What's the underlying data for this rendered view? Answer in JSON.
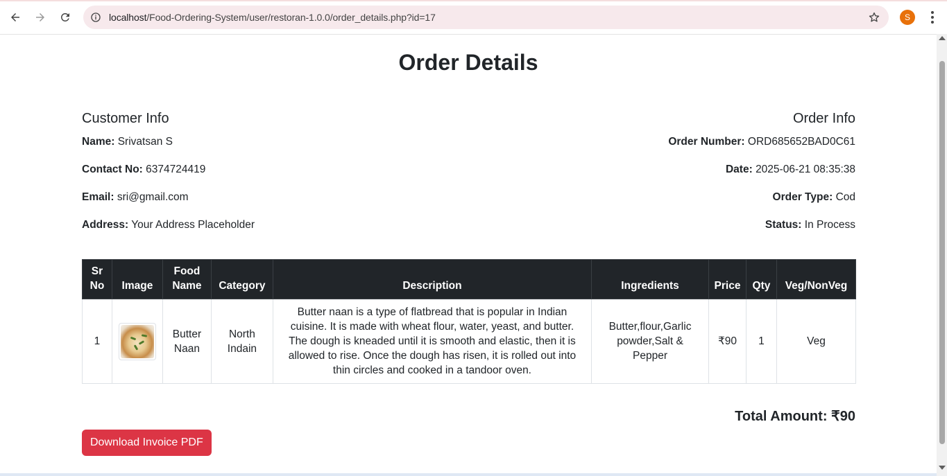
{
  "browser": {
    "url_host": "localhost",
    "url_path": "/Food-Ordering-System/user/restoran-1.0.0/order_details.php?id=17",
    "profile_initial": "S"
  },
  "page": {
    "title": "Order Details"
  },
  "customer": {
    "heading": "Customer Info",
    "name_label": "Name:",
    "name_value": "Srivatsan S",
    "contact_label": "Contact No:",
    "contact_value": "6374724419",
    "email_label": "Email:",
    "email_value": "sri@gmail.com",
    "address_label": "Address:",
    "address_value": "Your Address Placeholder"
  },
  "order": {
    "heading": "Order Info",
    "number_label": "Order Number:",
    "number_value": "ORD685652BAD0C61",
    "date_label": "Date:",
    "date_value": "2025-06-21 08:35:38",
    "type_label": "Order Type:",
    "type_value": "Cod",
    "status_label": "Status:",
    "status_value": "In Process"
  },
  "table": {
    "headers": {
      "sr_line1": "Sr",
      "sr_line2": "No",
      "image": "Image",
      "food_line1": "Food",
      "food_line2": "Name",
      "category": "Category",
      "description": "Description",
      "ingredients": "Ingredients",
      "price": "Price",
      "qty": "Qty",
      "veg": "Veg/NonVeg"
    },
    "rows": [
      {
        "sr": "1",
        "food_line1": "Butter",
        "food_line2": "Naan",
        "category_line1": "North",
        "category_line2": "Indain",
        "description": "Butter naan is a type of flatbread that is popular in Indian cuisine. It is made with wheat flour, water, yeast, and butter. The dough is kneaded until it is smooth and elastic, then it is allowed to rise. Once the dough has risen, it is rolled out into thin circles and cooked in a tandoor oven.",
        "ingredients": "Butter,flour,Garlic powder,Salt & Pepper",
        "price": "₹90",
        "qty": "1",
        "veg": "Veg"
      }
    ]
  },
  "summary": {
    "total_label": "Total Amount: ₹90"
  },
  "actions": {
    "download_label": "Download Invoice PDF"
  },
  "colors": {
    "table_header_bg": "#212529",
    "button_bg": "#dc3545",
    "omnibox_bg": "#f7e9ec",
    "profile_bg": "#e8710a"
  }
}
